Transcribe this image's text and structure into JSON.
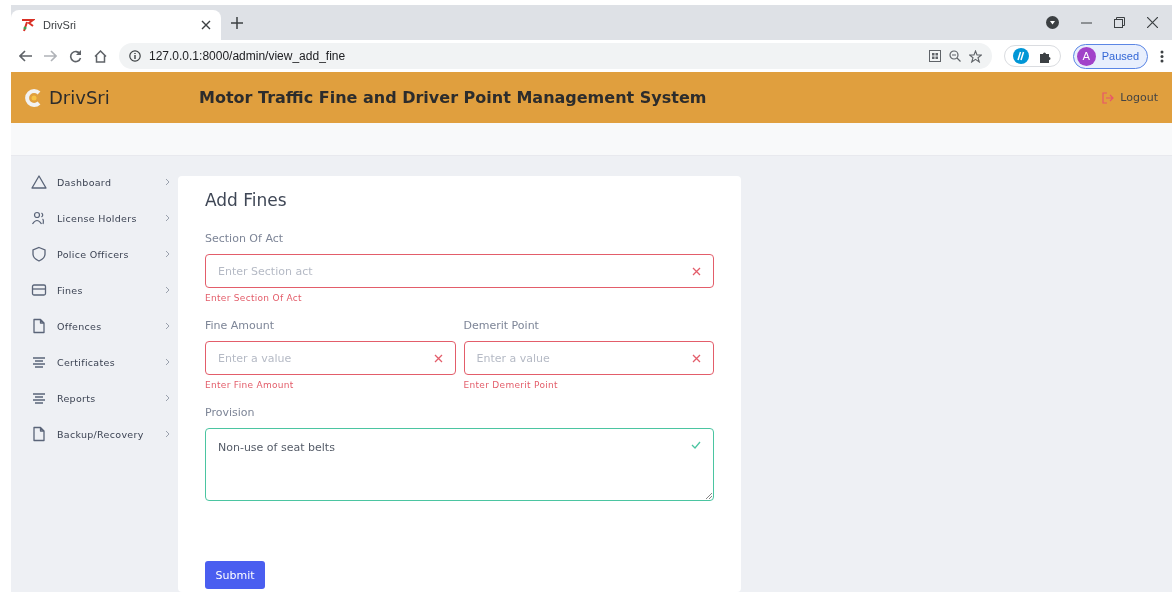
{
  "browser": {
    "tab_title": "DrivSri",
    "url": "127.0.0.1:8000/admin/view_add_fine",
    "profile_initial": "A",
    "profile_status": "Paused"
  },
  "header": {
    "brand": "DrivSri",
    "title": "Motor Traffic Fine and Driver Point Management System",
    "logout": "Logout"
  },
  "sidebar": {
    "items": [
      {
        "label": "Dashboard",
        "kind": "triangle"
      },
      {
        "label": "License Holders",
        "kind": "users"
      },
      {
        "label": "Police Officers",
        "kind": "shield"
      },
      {
        "label": "Fines",
        "kind": "card"
      },
      {
        "label": "Offences",
        "kind": "file"
      },
      {
        "label": "Certificates",
        "kind": "lines"
      },
      {
        "label": "Reports",
        "kind": "lines"
      },
      {
        "label": "Backup/Recovery",
        "kind": "file"
      }
    ]
  },
  "form": {
    "title": "Add Fines",
    "rows": [
      [
        {
          "label": "Section Of Act",
          "placeholder": "Enter Section act",
          "valid": false,
          "error": "Enter Section Of Act",
          "kind": "input"
        }
      ],
      [
        {
          "label": "Fine Amount",
          "placeholder": "Enter a value",
          "valid": false,
          "error": "Enter Fine Amount",
          "kind": "input"
        },
        {
          "label": "Demerit Point",
          "placeholder": "Enter a value",
          "valid": false,
          "error": "Enter Demerit Point",
          "kind": "input"
        }
      ],
      [
        {
          "label": "Provision",
          "value": "Non-use of seat belts",
          "valid": true,
          "kind": "textarea"
        }
      ]
    ],
    "submit": "Submit"
  }
}
